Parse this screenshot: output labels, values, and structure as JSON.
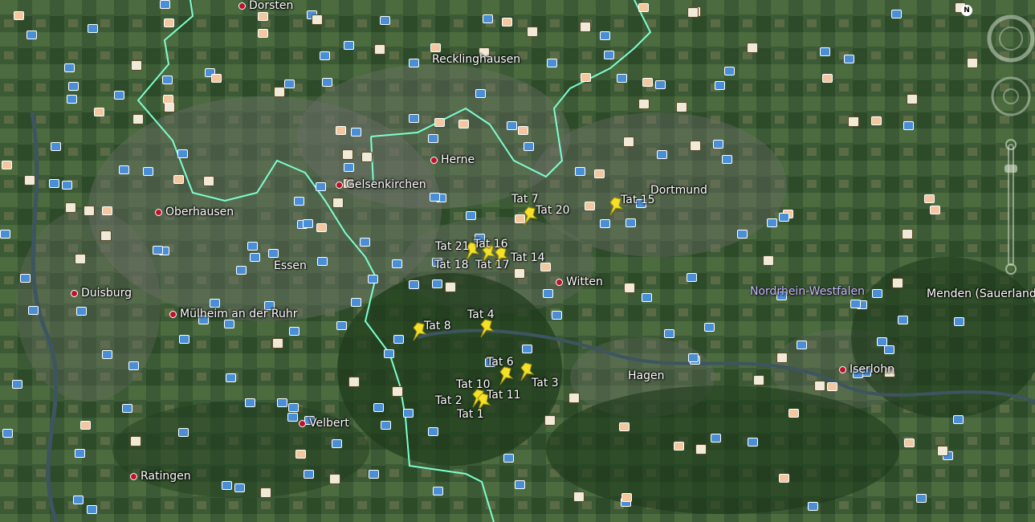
{
  "region_label": "Nordrhein-Westfalen",
  "compass_letter": "N",
  "cities": [
    {
      "name": "Dorsten"
    },
    {
      "name": "Recklinghausen"
    },
    {
      "name": "Herne"
    },
    {
      "name": "Gelsenkirchen"
    },
    {
      "name": "Dortmund"
    },
    {
      "name": "Oberhausen"
    },
    {
      "name": "Essen"
    },
    {
      "name": "Witten"
    },
    {
      "name": "Duisburg"
    },
    {
      "name": "Mülheim an der Ruhr"
    },
    {
      "name": "Menden (Sauerland)"
    },
    {
      "name": "Hagen"
    },
    {
      "name": "Iserlohn"
    },
    {
      "name": "Velbert"
    },
    {
      "name": "Ratingen"
    }
  ],
  "placemarks": [
    {
      "label": "Tat 7"
    },
    {
      "label": "Tat 20"
    },
    {
      "label": "Tat 15"
    },
    {
      "label": "Tat 21"
    },
    {
      "label": "Tat 16"
    },
    {
      "label": "Tat 14"
    },
    {
      "label": "Tat 18"
    },
    {
      "label": "Tat 17"
    },
    {
      "label": "Tat 4"
    },
    {
      "label": "Tat 8"
    },
    {
      "label": "Tat 6"
    },
    {
      "label": "Tat 3"
    },
    {
      "label": "Tat 10"
    },
    {
      "label": "Tat 11"
    },
    {
      "label": "Tat 2"
    },
    {
      "label": "Tat 1"
    }
  ],
  "colors": {
    "border": "#7dffd0",
    "pin": "#f5e12a",
    "city_dot": "#c0102a",
    "region_label": "#c9b6ff"
  },
  "icons": [
    "photo-icon",
    "museum-icon",
    "airport-icon",
    "hospital-icon",
    "park-icon",
    "compass-icon",
    "zoom-slider-icon"
  ]
}
